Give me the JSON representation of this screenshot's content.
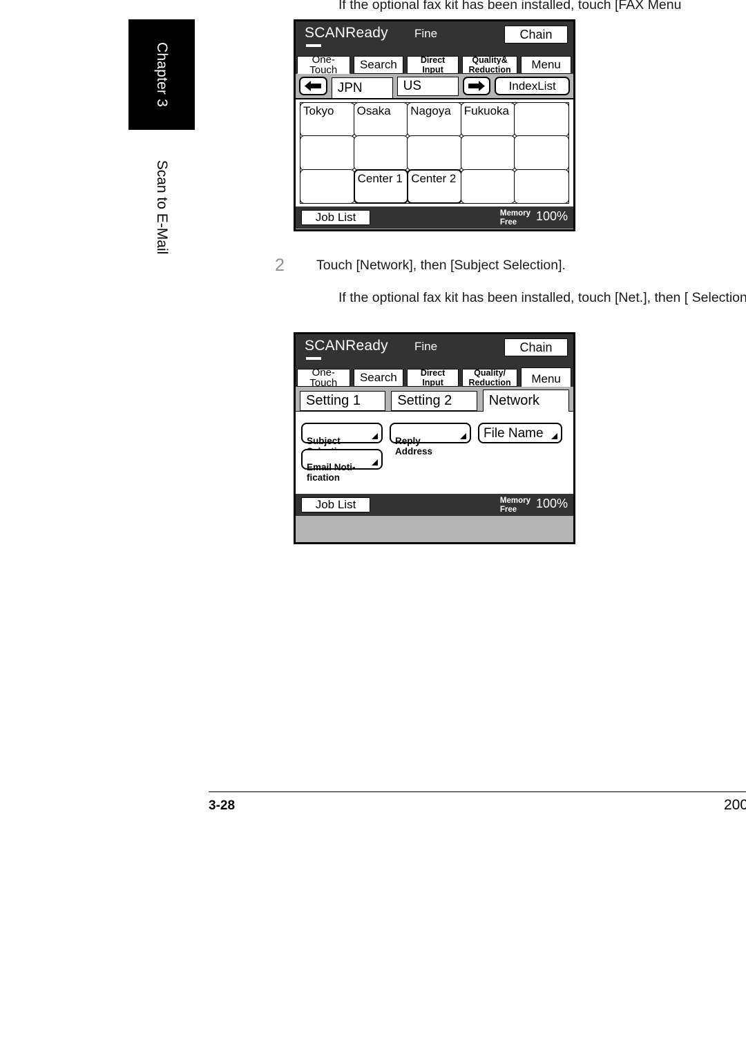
{
  "sidebar": {
    "chapter_label": "Chapter 3",
    "section_label": "Scan to E-Mail"
  },
  "page": {
    "note_top": "If the optional fax kit has been installed, touch [FAX Menu",
    "step_number": "2",
    "step_text": "Touch [Network], then [Subject Selection].",
    "note_mid": "If the optional fax kit has been installed, touch [Net.], then [ Selection].",
    "page_number": "3-28",
    "page_year": "200"
  },
  "panel_one_touch": {
    "status": "SCANReady",
    "quality": "Fine",
    "chain_label": "Chain",
    "toolbar": [
      {
        "label": "One-Touch",
        "active": true
      },
      {
        "label": "Search",
        "active": false
      },
      {
        "label": "Direct\nInput",
        "active": false
      },
      {
        "label": "Quality&\nReduction",
        "active": false
      },
      {
        "label": "Menu",
        "active": false
      }
    ],
    "nav": {
      "prev_icon": "arrow-left-icon",
      "next_icon": "arrow-right-icon",
      "tabs": [
        {
          "label": "JPN",
          "active": true
        },
        {
          "label": "US",
          "active": false
        }
      ],
      "index_label": "IndexList"
    },
    "grid": [
      [
        "Tokyo",
        "Osaka",
        "Nagoya",
        "Fukuoka",
        ""
      ],
      [
        "",
        "",
        "",
        "",
        ""
      ],
      [
        "",
        "Center 1",
        "Center 2",
        "",
        ""
      ]
    ],
    "grid_strong": [
      [
        false,
        false,
        false,
        false,
        false
      ],
      [
        false,
        false,
        false,
        false,
        false
      ],
      [
        false,
        true,
        true,
        false,
        false
      ]
    ],
    "footer": {
      "job_list_label": "Job List",
      "memory_label": "Memory\nFree",
      "memory_value": "100%"
    }
  },
  "panel_network": {
    "status": "SCANReady",
    "quality": "Fine",
    "chain_label": "Chain",
    "toolbar": [
      {
        "label": "One-Touch",
        "active": false
      },
      {
        "label": "Search",
        "active": false
      },
      {
        "label": "Direct\nInput",
        "active": false
      },
      {
        "label": "Quality/\nReduction",
        "active": false
      },
      {
        "label": "Menu",
        "active": true
      }
    ],
    "tabs": [
      {
        "label": "Setting 1",
        "active": false
      },
      {
        "label": "Setting 2",
        "active": false
      },
      {
        "label": "Network",
        "active": true
      }
    ],
    "options": [
      {
        "label": "Subject\nSelection",
        "style": "small"
      },
      {
        "label": "Reply\nAddress",
        "style": "small"
      },
      {
        "label": "File Name",
        "style": "big"
      },
      {
        "label": "Email Noti-\nfication",
        "style": "small"
      }
    ],
    "footer": {
      "job_list_label": "Job List",
      "memory_label": "Memory\nFree",
      "memory_value": "100%"
    }
  }
}
